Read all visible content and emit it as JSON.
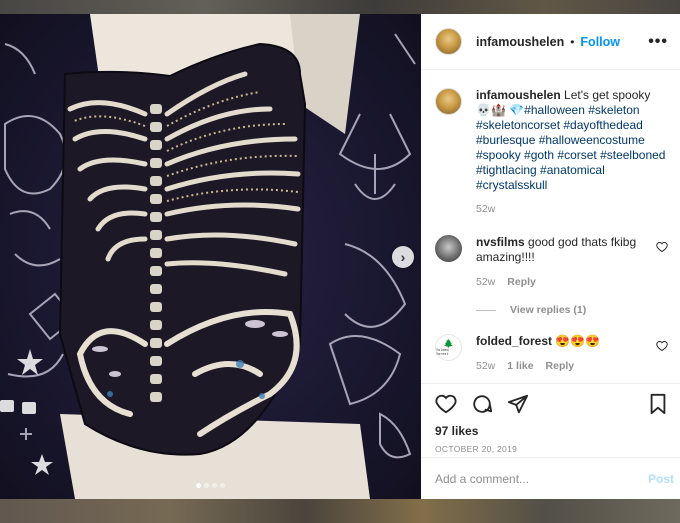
{
  "post": {
    "username": "infamoushelen",
    "header_separator": "•",
    "follow_label": "Follow",
    "more_label": "•••",
    "caption_text": "Let's get spooky 💀🏰",
    "caption_hashtags": "💎#halloween #skeleton #skeletoncorset #dayofthedead #burlesque #halloweencostume #spooky #goth #corset #steelboned #tightlacing #anatomical #crystalsskull",
    "caption_age": "52w",
    "likes": "97 likes",
    "date": "OCTOBER 20, 2019",
    "comment_placeholder": "Add a comment...",
    "post_label": "Post"
  },
  "comments": [
    {
      "username": "nvsfilms",
      "text": "good god thats fkibg amazing!!!!",
      "age": "52w",
      "reply_label": "Reply",
      "view_replies": "View replies (1)"
    },
    {
      "username": "folded_forest",
      "text": "😍😍😍",
      "age": "52w",
      "likes_label": "1 like",
      "reply_label": "Reply"
    }
  ],
  "avatar_text": {
    "folded_forest_logo": "folded forest"
  },
  "carousel": {
    "next_icon": "chevron-right-icon",
    "dot_count": 4,
    "active_dot": 0
  },
  "colors": {
    "accent": "#0095f6",
    "hashtag": "#00376b",
    "muted": "#8e8e8e",
    "post_disabled": "#b2dffc"
  }
}
